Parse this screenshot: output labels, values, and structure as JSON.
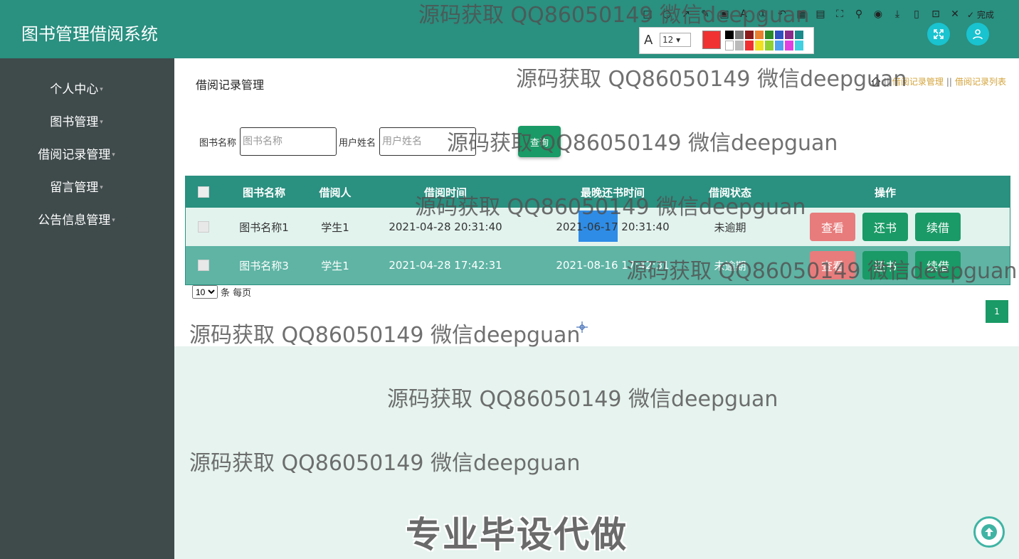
{
  "app": {
    "title": "图书管理借阅系统"
  },
  "sidebar": {
    "items": [
      {
        "label": "个人中心"
      },
      {
        "label": "图书管理"
      },
      {
        "label": "借阅记录管理"
      },
      {
        "label": "留言管理"
      },
      {
        "label": "公告信息管理"
      }
    ]
  },
  "page": {
    "title": "借阅记录管理"
  },
  "breadcrumb": {
    "items": [
      "借阅记录管理",
      "借阅记录列表"
    ],
    "separator": "||"
  },
  "search": {
    "book_label": "图书名称",
    "book_placeholder": "图书名称",
    "user_label": "用户姓名",
    "user_placeholder": "用户姓名",
    "query_button": "查询"
  },
  "table": {
    "columns": [
      "图书名称",
      "借阅人",
      "借阅时间",
      "最晚还书时间",
      "借阅状态",
      "操作"
    ],
    "rows": [
      {
        "book": "图书名称1",
        "borrower": "学生1",
        "borrow_time": "2021-04-28 20:31:40",
        "due_time": "2021-06-17 20:31:40",
        "status": "未逾期"
      },
      {
        "book": "图书名称3",
        "borrower": "学生1",
        "borrow_time": "2021-04-28 17:42:31",
        "due_time": "2021-08-16 17:42:31",
        "status": "未逾期"
      }
    ],
    "actions": {
      "view": "查看",
      "return": "还书",
      "renew": "续借"
    }
  },
  "pagination": {
    "page_size": "10",
    "per_page_text": "条 每页",
    "current_page": "1"
  },
  "screenshot_toolbar": {
    "font_size": "12",
    "done_label": "完成"
  },
  "watermarks": {
    "text": "源码获取 QQ86050149 微信deepguan",
    "banner": "专业毕设代做"
  },
  "colors": {
    "header": "#2a9080",
    "sidebar": "#3f4a4b",
    "accent_green": "#1a9a66",
    "view_button": "#e87c7c",
    "breadcrumb": "#d4a43c",
    "lower_bg": "#e6f3ee"
  }
}
